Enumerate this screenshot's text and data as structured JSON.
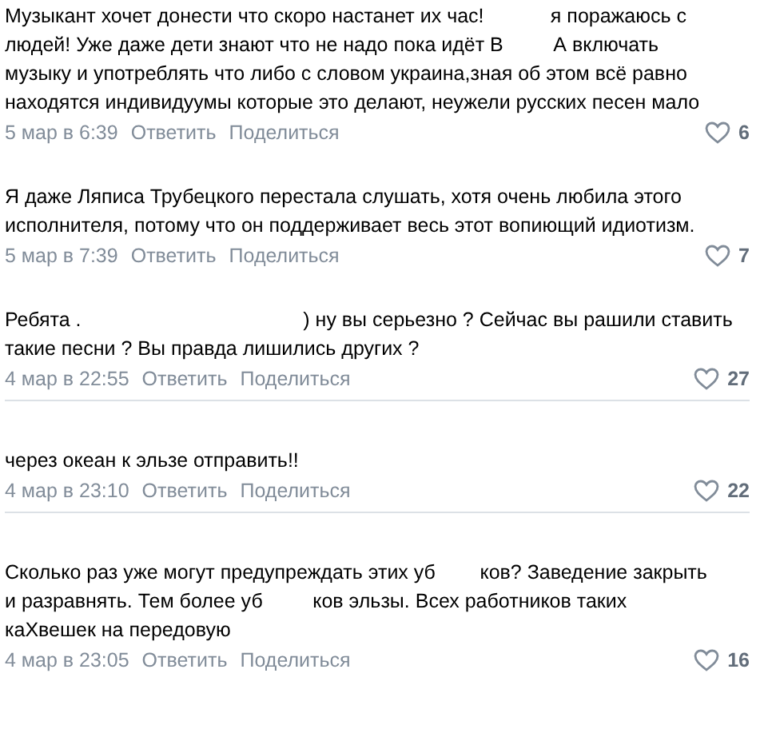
{
  "comments": [
    {
      "lines": [
        "Музыкант хочет донести что скоро настанет их час!            я поражаюсь с",
        "людей! Уже даже дети знают что не надо пока идёт В         А включать",
        "музыку и употреблять что либо с словом украина,зная об этом всё равно",
        "находятся индивидуумы которые это делают, неужели русских песен мало"
      ],
      "date": "5 мар в 6:39",
      "reply": "Ответить",
      "share": "Поделиться",
      "likes": "6",
      "divider": false
    },
    {
      "lines": [
        "Я даже Ляписа Трубецкого перестала слушать, хотя очень любила этого",
        "исполнителя, потому что он поддерживает весь этот вопиющий идиотизм."
      ],
      "date": "5 мар в 7:39",
      "reply": "Ответить",
      "share": "Поделиться",
      "likes": "7",
      "divider": false
    },
    {
      "lines": [
        "Ребята .                                        ) ну вы серьезно ? Сейчас вы рашили ставить",
        "такие песни ? Вы правда лишились других ?"
      ],
      "date": "4 мар в 22:55",
      "reply": "Ответить",
      "share": "Поделиться",
      "likes": "27",
      "divider": true
    },
    {
      "lines": [
        "через океан к эльзе отправить!!"
      ],
      "date": "4 мар в 23:10",
      "reply": "Ответить",
      "share": "Поделиться",
      "likes": "22",
      "divider": true
    },
    {
      "lines": [
        "Сколько раз уже могут предупреждать этих уб        ков? Заведение закрыть",
        "и разравнять. Тем более уб         ков эльзы. Всех работников таких",
        "каХвешек на передовую"
      ],
      "date": "4 мар в 23:05",
      "reply": "Ответить",
      "share": "Поделиться",
      "likes": "16",
      "divider": false
    }
  ]
}
